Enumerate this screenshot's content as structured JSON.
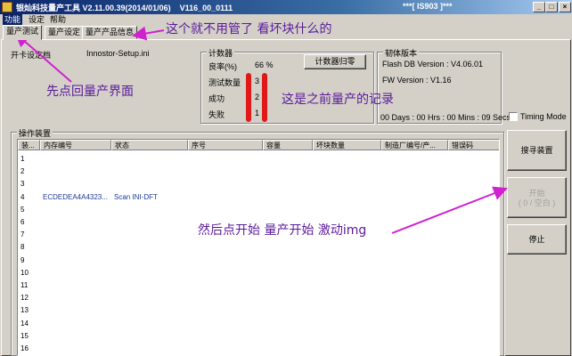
{
  "window": {
    "title": "银灿科技量产工具 V2.11.00.39(2014/01/06)    V116_00_0111",
    "title_right": "***[ IS903 ]***",
    "minimize": "_",
    "maximize": "□",
    "close": "×"
  },
  "menu": [
    "功能",
    "设定",
    "帮助"
  ],
  "tabs": [
    "量产测试",
    "量产设定",
    "量产产品信息"
  ],
  "settings_file": {
    "label": "开卡设定档",
    "value": "Innostor-Setup.ini"
  },
  "counter": {
    "group_title": "计数器",
    "yield_label": "良率(%)",
    "yield_value": "66 %",
    "reset_button": "计数器归零",
    "tested_label": "测试数量",
    "tested_value": "3",
    "success_label": "成功",
    "success_value": "2",
    "fail_label": "失败",
    "fail_value": "1"
  },
  "firmware": {
    "group_title": "韧体版本",
    "flash_db": "Flash DB Version :  V4.06.01",
    "fw_version": "FW Version :   V1.16",
    "elapsed": "00 Days : 00 Hrs : 00 Mins : 09 Secs",
    "timing_mode_label": "Timing Mode",
    "timing_mode_checked": false
  },
  "devices": {
    "group_title": "操作装置",
    "columns": [
      "装...",
      "内存编号",
      "状态",
      "序号",
      "容量",
      "坏块数量",
      "制造厂编号/产...",
      "错误码"
    ],
    "rows": [
      [
        "1",
        "",
        "",
        "",
        "",
        "",
        "",
        ""
      ],
      [
        "2",
        "",
        "",
        "",
        "",
        "",
        "",
        ""
      ],
      [
        "3",
        "",
        "",
        "",
        "",
        "",
        "",
        ""
      ],
      [
        "4",
        "ECDEDEA4A4323...",
        "Scan INI-DFT",
        "",
        "",
        "",
        "",
        ""
      ],
      [
        "5",
        "",
        "",
        "",
        "",
        "",
        "",
        ""
      ],
      [
        "6",
        "",
        "",
        "",
        "",
        "",
        "",
        ""
      ],
      [
        "7",
        "",
        "",
        "",
        "",
        "",
        "",
        ""
      ],
      [
        "8",
        "",
        "",
        "",
        "",
        "",
        "",
        ""
      ],
      [
        "9",
        "",
        "",
        "",
        "",
        "",
        "",
        ""
      ],
      [
        "10",
        "",
        "",
        "",
        "",
        "",
        "",
        ""
      ],
      [
        "11",
        "",
        "",
        "",
        "",
        "",
        "",
        ""
      ],
      [
        "12",
        "",
        "",
        "",
        "",
        "",
        "",
        ""
      ],
      [
        "13",
        "",
        "",
        "",
        "",
        "",
        "",
        ""
      ],
      [
        "14",
        "",
        "",
        "",
        "",
        "",
        "",
        ""
      ],
      [
        "15",
        "",
        "",
        "",
        "",
        "",
        "",
        ""
      ],
      [
        "16",
        "",
        "",
        "",
        "",
        "",
        "",
        ""
      ]
    ]
  },
  "buttons": {
    "search": "搜寻装置",
    "start_line1": "开始",
    "start_line2": "( 0 / 空白 )",
    "stop": "停止"
  },
  "annotations": {
    "top": "这个就不用管了 看坏块什么的",
    "left": "先点回量产界面",
    "counter": "这是之前量产的记录",
    "start": "然后点开始  量产开始 激动img"
  },
  "colors": {
    "annotation": "#5a1a9a",
    "arrow": "#d020d0",
    "marker": "#e01818",
    "titlebar": "#0a246a"
  }
}
